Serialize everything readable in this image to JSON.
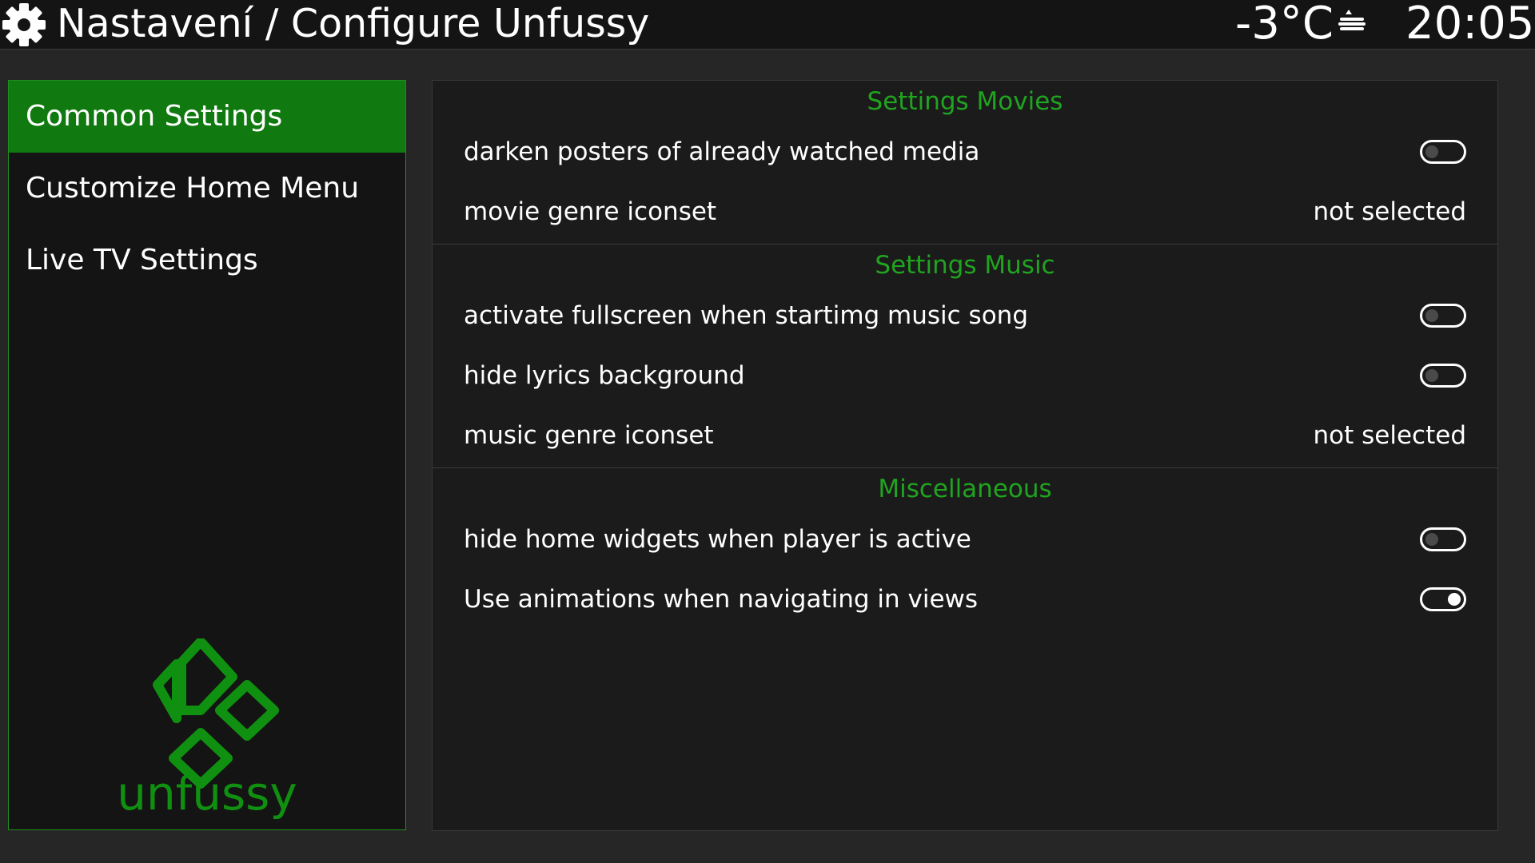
{
  "header": {
    "title": "Nastavení / Configure Unfussy",
    "temperature": "-3°C",
    "weather_icon": "cloudy-snow-icon",
    "clock": "20:05"
  },
  "sidebar": {
    "items": [
      {
        "label": "Common Settings",
        "active": true
      },
      {
        "label": "Customize Home Menu",
        "active": false
      },
      {
        "label": "Live TV Settings",
        "active": false
      }
    ],
    "logo_text": "unfussy",
    "brand_color": "#109010"
  },
  "settings": {
    "movies": {
      "header": "Settings Movies",
      "rows": [
        {
          "label": "darken posters of already watched media",
          "type": "toggle",
          "enabled": false
        },
        {
          "label": "movie genre iconset",
          "type": "value",
          "value": "not selected"
        }
      ]
    },
    "music": {
      "header": "Settings Music",
      "rows": [
        {
          "label": "activate fullscreen when startimg music song",
          "type": "toggle",
          "enabled": false
        },
        {
          "label": "hide lyrics background",
          "type": "toggle",
          "enabled": false
        },
        {
          "label": "music genre iconset",
          "type": "value",
          "value": "not selected"
        }
      ]
    },
    "misc": {
      "header": "Miscellaneous",
      "rows": [
        {
          "label": "hide home widgets when player is active",
          "type": "toggle",
          "enabled": false
        },
        {
          "label": "Use animations when navigating in views",
          "type": "toggle",
          "enabled": true
        }
      ]
    }
  },
  "colors": {
    "accent": "#20a420",
    "selected": "#107a10"
  }
}
